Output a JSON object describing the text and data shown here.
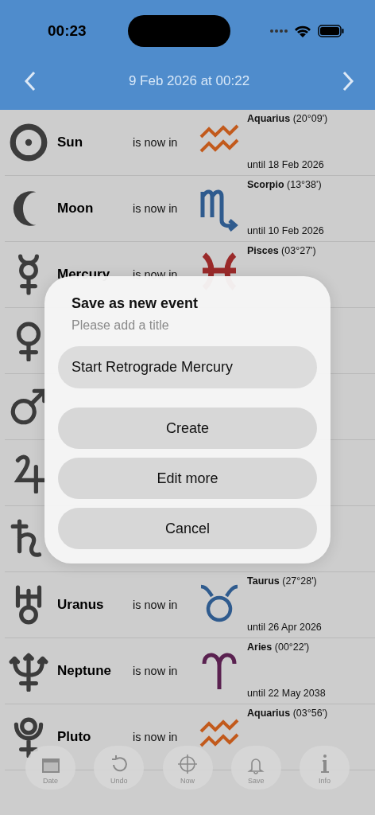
{
  "status_bar": {
    "time": "00:23"
  },
  "header": {
    "title": "9 Feb 2026 at 00:22"
  },
  "rows": [
    {
      "kind": "full",
      "name": "Sun",
      "phrase": "is now in",
      "sign": "Aquarius",
      "degree": "(20°09')",
      "until": "until 18 Feb 2026",
      "color": "#c25a1c"
    },
    {
      "kind": "full",
      "name": "Moon",
      "phrase": "is now in",
      "sign": "Scorpio",
      "degree": "(13°38')",
      "until": "until 10 Feb 2026",
      "color": "#2f5b8e"
    },
    {
      "kind": "full",
      "name": "Mercury",
      "phrase": "is now in",
      "sign": "Pisces",
      "degree": "(03°27')",
      "color": "#9a2a2a"
    },
    {
      "kind": "covered"
    },
    {
      "kind": "covered"
    },
    {
      "kind": "covered"
    },
    {
      "kind": "covered"
    },
    {
      "kind": "full",
      "name": "Uranus",
      "phrase": "is now in",
      "sign": "Taurus",
      "degree": "(27°28')",
      "until": "until 26 Apr 2026",
      "color": "#2f5b8e"
    },
    {
      "kind": "full",
      "name": "Neptune",
      "phrase": "is now in",
      "sign": "Aries",
      "degree": "(00°22')",
      "until": "until 22 May 2038",
      "color": "#5a2150"
    },
    {
      "kind": "full",
      "name": "Pluto",
      "phrase": "is now in",
      "sign": "Aquarius",
      "degree": "(03°56')",
      "color": "#c25a1c"
    }
  ],
  "toolbar": [
    {
      "label": "Date"
    },
    {
      "label": "Undo"
    },
    {
      "label": "Now"
    },
    {
      "label": "Save"
    },
    {
      "label": "Info"
    }
  ],
  "dialog": {
    "title": "Save as new event",
    "subtitle": "Please add a title",
    "field": {
      "value": "Start Retrograde Mercury"
    },
    "buttons": [
      "Create",
      "Edit more",
      "Cancel"
    ]
  }
}
